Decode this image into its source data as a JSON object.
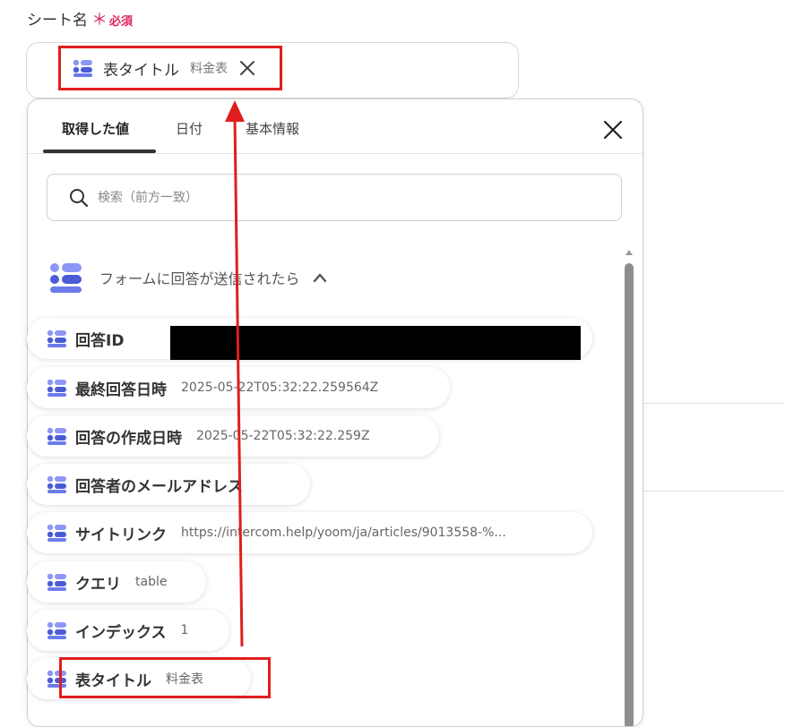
{
  "field": {
    "label": "シート名",
    "required_star": "＊",
    "required_text": "必須",
    "selected_chip": {
      "label": "表タイトル",
      "value": "料金表"
    }
  },
  "panel": {
    "tabs": [
      {
        "label": "取得した値",
        "active": true
      },
      {
        "label": "日付",
        "active": false
      },
      {
        "label": "基本情報",
        "active": false
      }
    ],
    "search_placeholder": "検索（前方一致）",
    "group": {
      "title": "フォームに回答が送信されたら",
      "items": [
        {
          "label": "回答ID",
          "value": ""
        },
        {
          "label": "最終回答日時",
          "value": "2025-05-22T05:32:22.259564Z"
        },
        {
          "label": "回答の作成日時",
          "value": "2025-05-22T05:32:22.259Z"
        },
        {
          "label": "回答者のメールアドレス",
          "value": ""
        },
        {
          "label": "サイトリンク",
          "value": "https://intercom.help/yoom/ja/articles/9013558-%..."
        },
        {
          "label": "クエリ",
          "value": "table"
        },
        {
          "label": "インデックス",
          "value": "1"
        },
        {
          "label": "表タイトル",
          "value": "料金表"
        }
      ]
    }
  },
  "colors": {
    "accent_icon": "#5a6cf0",
    "required": "#e0245e",
    "annotation_red": "#e01e1e"
  },
  "icons": [
    "list-icon",
    "close-icon",
    "search-icon",
    "chevron-up-icon",
    "scroll-up-icon"
  ]
}
